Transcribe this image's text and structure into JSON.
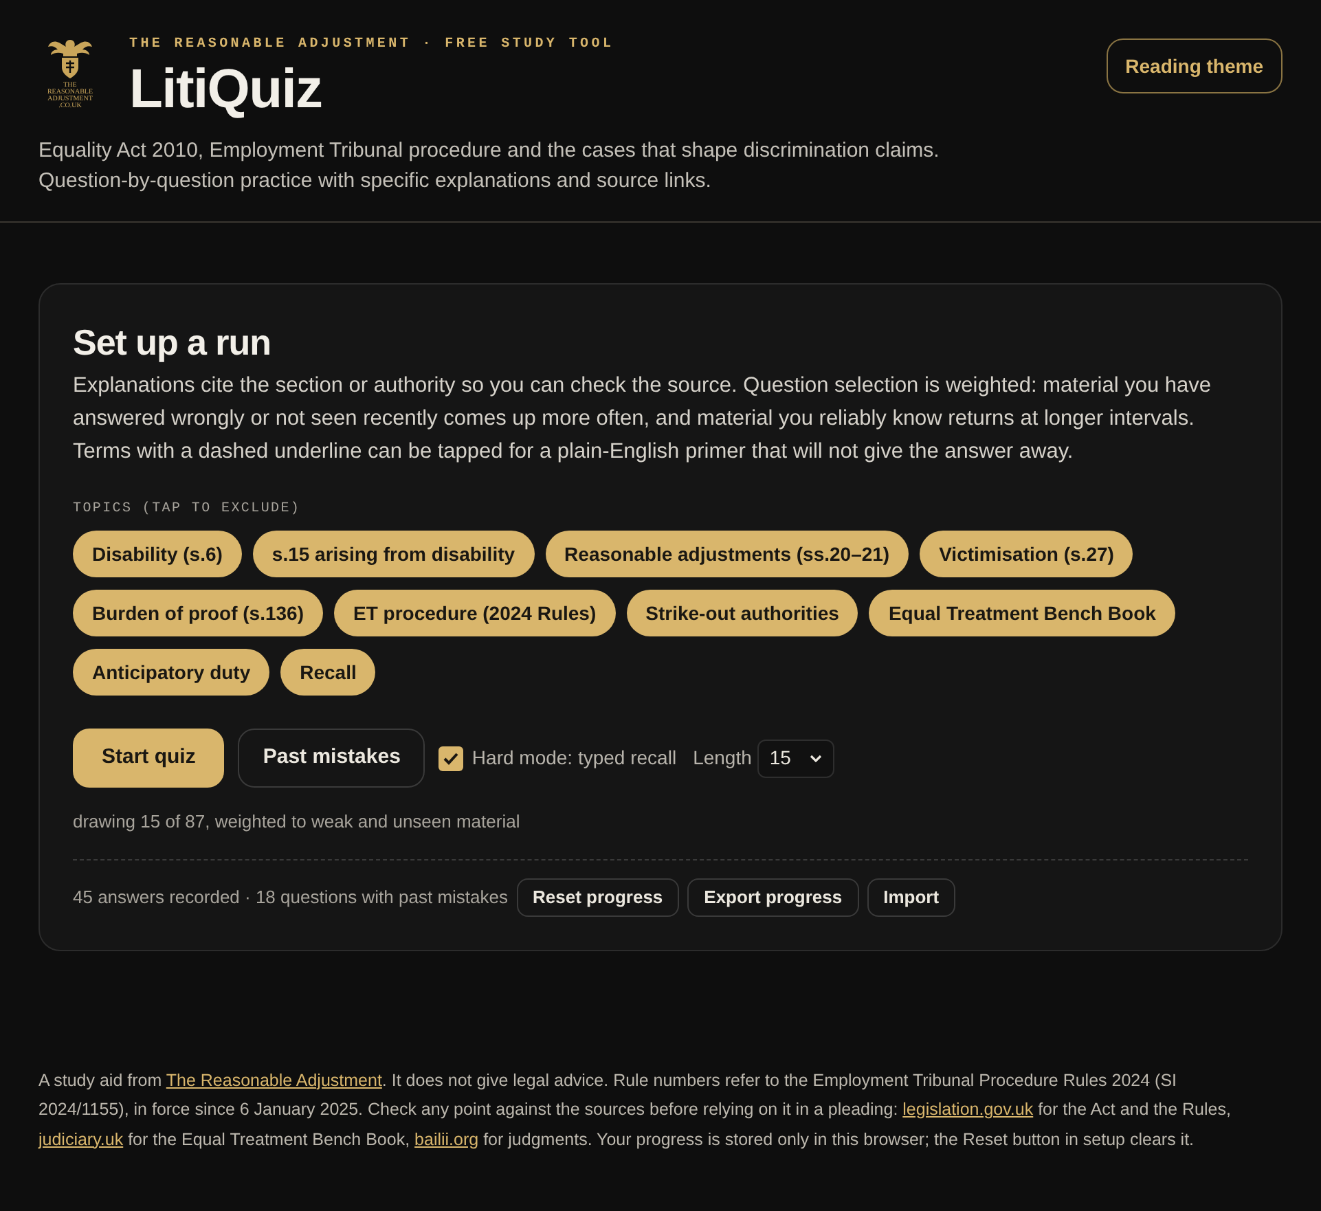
{
  "header": {
    "logo_text": [
      "THE",
      "REASONABLE",
      "ADJUSTMENT",
      ".CO.UK"
    ],
    "kicker": "THE REASONABLE ADJUSTMENT · FREE STUDY TOOL",
    "title": "LitiQuiz",
    "description": "Equality Act 2010, Employment Tribunal procedure and the cases that shape discrimination claims. Question-by-question practice with specific explanations and source links.",
    "theme_button": "Reading theme"
  },
  "setup": {
    "title": "Set up a run",
    "intro": "Explanations cite the section or authority so you can check the source. Question selection is weighted: material you have answered wrongly or not seen recently comes up more often, and material you reliably know returns at longer intervals. Terms with a dashed underline can be tapped for a plain-English primer that will not give the answer away.",
    "topics_label": "TOPICS (TAP TO EXCLUDE)",
    "topics": [
      {
        "label": "Disability (s.6)",
        "excluded": false
      },
      {
        "label": "s.15 arising from disability",
        "excluded": false
      },
      {
        "label": "Reasonable adjustments (ss.20–21)",
        "excluded": false
      },
      {
        "label": "Victimisation (s.27)",
        "excluded": false
      },
      {
        "label": "Burden of proof (s.136)",
        "excluded": false
      },
      {
        "label": "ET procedure (2024 Rules)",
        "excluded": false
      },
      {
        "label": "Strike-out authorities",
        "excluded": false
      },
      {
        "label": "Equal Treatment Bench Book",
        "excluded": false
      },
      {
        "label": "Anticipatory duty",
        "excluded": false
      },
      {
        "label": "Recall",
        "excluded": false
      }
    ],
    "start_button": "Start quiz",
    "mistakes_button": "Past mistakes",
    "hard_mode": {
      "label": "Hard mode: typed recall",
      "checked": true
    },
    "length": {
      "label": "Length",
      "value": "15"
    },
    "summary": "drawing 15 of 87, weighted to weak and unseen material",
    "stats": "45 answers recorded · 18 questions with past mistakes",
    "actions": [
      "Reset progress",
      "Export progress",
      "Import"
    ]
  },
  "footer": {
    "segments": [
      {
        "kind": "text",
        "text": "A study aid from "
      },
      {
        "kind": "link",
        "text": "The Reasonable Adjustment"
      },
      {
        "kind": "text",
        "text": ". It does not give legal advice. Rule numbers refer to the Employment Tribunal Procedure Rules 2024 (SI 2024/1155), in force since 6 January 2025. Check any point against the sources before relying on it in a pleading: "
      },
      {
        "kind": "link",
        "text": "legislation.gov.uk"
      },
      {
        "kind": "text",
        "text": " for the Act and the Rules, "
      },
      {
        "kind": "link",
        "text": "judiciary.uk"
      },
      {
        "kind": "text",
        "text": " for the Equal Treatment Bench Book, "
      },
      {
        "kind": "link",
        "text": "bailii.org"
      },
      {
        "kind": "text",
        "text": " for judgments. Your progress is stored only in this browser; the Reset button in setup clears it."
      }
    ]
  }
}
